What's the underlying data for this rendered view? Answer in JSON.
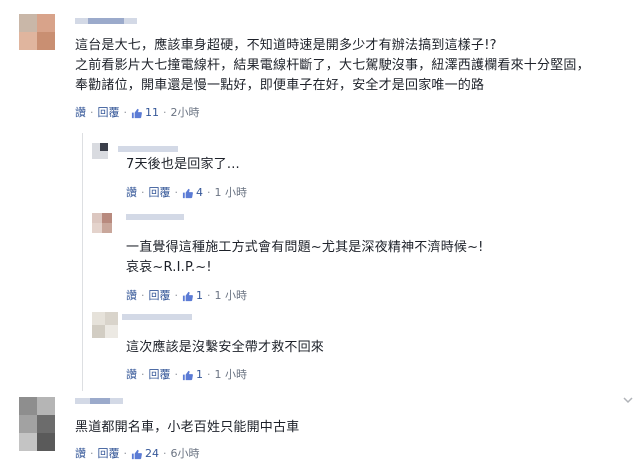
{
  "comments": [
    {
      "id": "c1",
      "text_lines": [
        "這台是大七，應該車身超硬，不知道時速是開多少才有辦法搞到這樣子!?",
        "之前看影片大七撞電線杆，結果電線杆斷了，大七駕駛沒事，紐澤西護欄看來十分堅固，",
        "奉勸諸位，開車還是慢一點好，即便車子在好，安全才是回家唯一的路"
      ],
      "reply_label": "讚",
      "reply_link": "回覆",
      "likes": "11",
      "time": "2小時"
    },
    {
      "id": "r1",
      "text_lines": [
        "7天後也是回家了..."
      ],
      "reply_label": "讚",
      "reply_link": "回覆",
      "likes": "4",
      "time": "1 小時"
    },
    {
      "id": "r2",
      "text_lines": [
        "一直覺得這種施工方式會有問題~尤其是深夜精神不濟時候~!",
        "哀哀~R.I.P.~!"
      ],
      "reply_label": "讚",
      "reply_link": "回覆",
      "likes": "1",
      "time": "1 小時"
    },
    {
      "id": "r3",
      "text_lines": [
        "這次應該是沒繫安全帶才救不回來"
      ],
      "reply_label": "讚",
      "reply_link": "回覆",
      "likes": "1",
      "time": "1 小時"
    },
    {
      "id": "c2",
      "text_lines": [
        "黑道都開名車，小老百姓只能開中古車"
      ],
      "reply_label": "讚",
      "reply_link": "回覆",
      "likes": "24",
      "time": "6小時"
    }
  ],
  "colors": {
    "link": "#365899",
    "text": "#1d2129",
    "meta": "#90949c",
    "like_icon": "#5b7bd5"
  }
}
